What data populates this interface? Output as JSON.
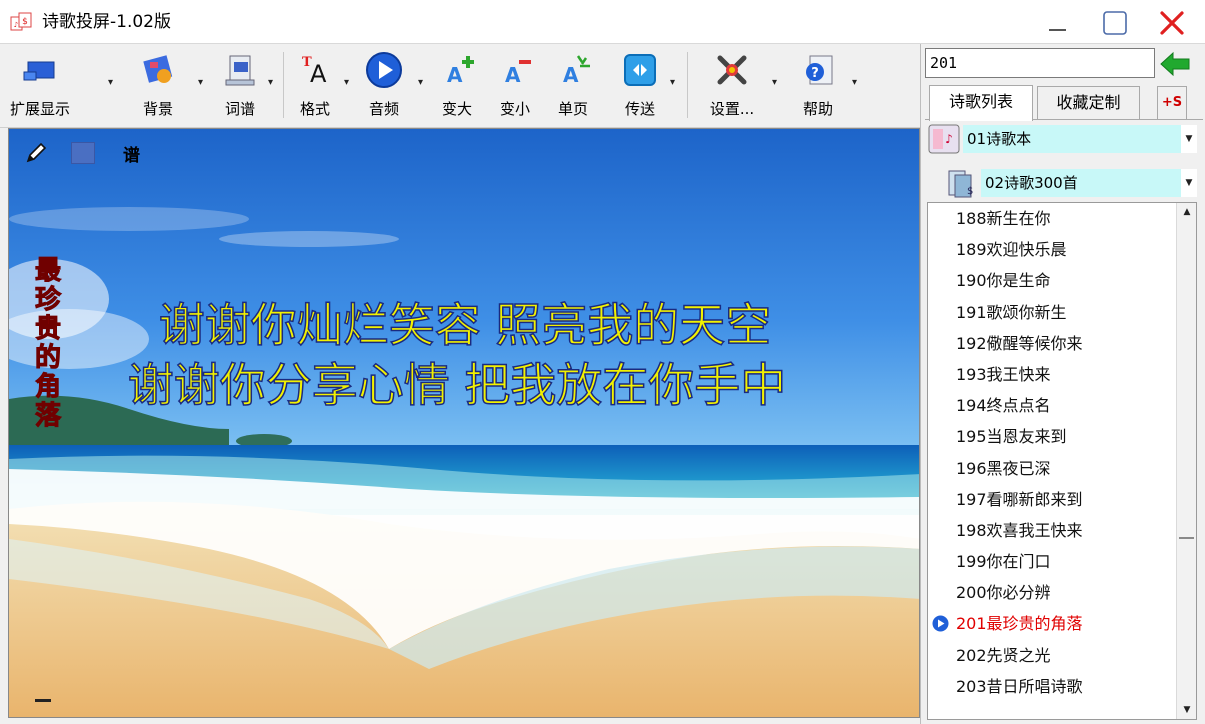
{
  "window": {
    "title": "诗歌投屏-1.02版"
  },
  "toolbar": {
    "items": [
      {
        "label": "扩展显示",
        "icon": "monitor-icon"
      },
      {
        "label": "背景",
        "icon": "background-icon"
      },
      {
        "label": "词谱",
        "icon": "score-icon"
      },
      {
        "label": "格式",
        "icon": "format-icon"
      },
      {
        "label": "音频",
        "icon": "play-icon"
      },
      {
        "label": "变大",
        "icon": "font-larger-icon"
      },
      {
        "label": "变小",
        "icon": "font-smaller-icon"
      },
      {
        "label": "单页",
        "icon": "single-page-icon"
      },
      {
        "label": "传送",
        "icon": "transfer-icon"
      },
      {
        "label": "设置...",
        "icon": "settings-icon"
      },
      {
        "label": "帮助",
        "icon": "help-icon"
      }
    ]
  },
  "display": {
    "edit_label": "谱",
    "side_title": "最珍贵的角落",
    "lyrics": [
      "谢谢你灿烂笑容  照亮我的天空",
      "谢谢你分享心情  把我放在你手中"
    ],
    "lyric_color": "#f2f200",
    "side_title_color": "#e60000"
  },
  "panel": {
    "search_value": "201",
    "tabs": {
      "poems": "诗歌列表",
      "favorites": "收藏定制",
      "add": "+S"
    },
    "book": "01诗歌本",
    "collection": "02诗歌300首",
    "items": [
      "188新生在你",
      "189欢迎快乐晨",
      "190你是生命",
      "191歌颂你新生",
      "192儆醒等候你来",
      "193我王快来",
      "194终点点名",
      "195当恩友来到",
      "196黑夜已深",
      "197看哪新郎来到",
      "198欢喜我王快来",
      "199你在门口",
      "200你必分辨",
      "201最珍贵的角落",
      "202先贤之光",
      "203昔日所唱诗歌"
    ],
    "selected_item": "201最珍贵的角落",
    "selected_color": "#e00000",
    "combo_color": "#c8f8f8"
  }
}
